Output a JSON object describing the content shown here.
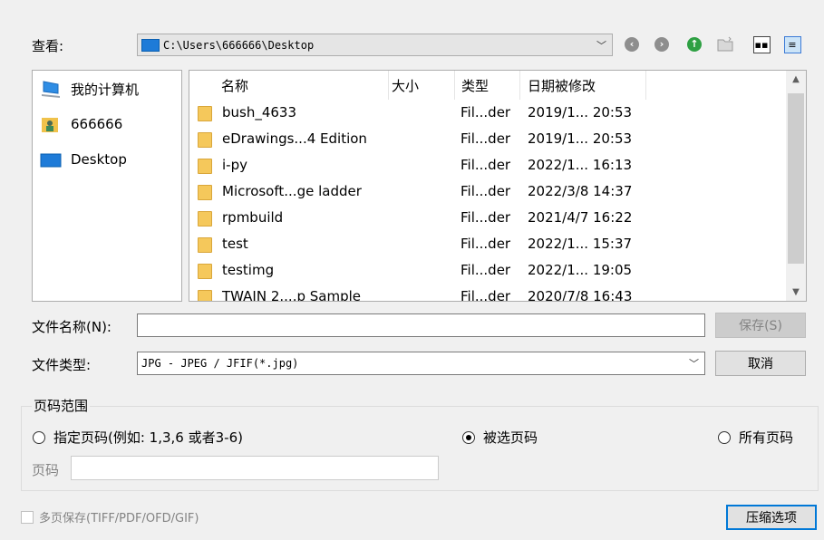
{
  "look_in": {
    "label": "查看:",
    "path": "C:\\Users\\666666\\Desktop"
  },
  "toolbar": {
    "back_icon": "back-icon",
    "forward_icon": "forward-icon",
    "up_icon": "up-folder-icon",
    "new_folder_icon": "new-folder-icon",
    "list_view_icon": "list-view-icon",
    "detail_view_icon": "detail-view-icon"
  },
  "places": [
    {
      "label": "我的计算机",
      "icon": "computer-icon"
    },
    {
      "label": "666666",
      "icon": "user-icon"
    },
    {
      "label": "Desktop",
      "icon": "desktop-icon"
    }
  ],
  "columns": {
    "name": "名称",
    "size": "大小",
    "type": "类型",
    "modified": "日期被修改"
  },
  "files": [
    {
      "name": "bush_4633",
      "type": "Fil...der",
      "modified": "2019/1... 20:53"
    },
    {
      "name": "eDrawings...4 Edition",
      "type": "Fil...der",
      "modified": "2019/1... 20:53"
    },
    {
      "name": "i-py",
      "type": "Fil...der",
      "modified": "2022/1... 16:13"
    },
    {
      "name": "Microsoft...ge ladder",
      "type": "Fil...der",
      "modified": "2022/3/8 14:37"
    },
    {
      "name": "rpmbuild",
      "type": "Fil...der",
      "modified": "2021/4/7 16:22"
    },
    {
      "name": "test",
      "type": "Fil...der",
      "modified": "2022/1... 15:37"
    },
    {
      "name": "testimg",
      "type": "Fil...der",
      "modified": "2022/1... 19:05"
    },
    {
      "name": "TWAIN 2....p Sample",
      "type": "Fil...der",
      "modified": "2020/7/8 16:43"
    }
  ],
  "file_name": {
    "label": "文件名称(N):",
    "value": ""
  },
  "file_type": {
    "label": "文件类型:",
    "value": "JPG - JPEG / JFIF(*.jpg)"
  },
  "buttons": {
    "save": "保存(S)",
    "cancel": "取消",
    "compress": "压缩选项"
  },
  "page_range": {
    "title": "页码范围",
    "specify": "指定页码(例如: 1,3,6 或者3-6)",
    "selected": "被选页码",
    "all": "所有页码",
    "page_label": "页码",
    "page_value": "",
    "checked": "selected"
  },
  "multipage": {
    "label": "多页保存(TIFF/PDF/OFD/GIF)",
    "checked": false
  }
}
